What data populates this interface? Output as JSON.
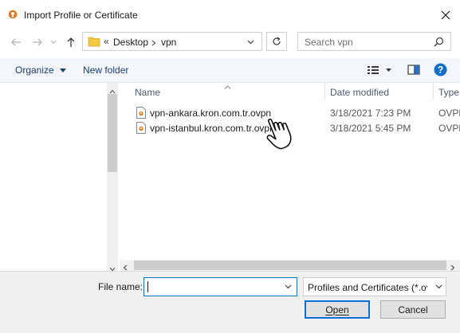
{
  "window": {
    "title": "Import Profile or Certificate"
  },
  "address": {
    "chevrons": "«",
    "crumbs": [
      "Desktop",
      "vpn"
    ]
  },
  "search": {
    "placeholder": "Search vpn"
  },
  "toolbar": {
    "organize": "Organize",
    "new_folder": "New folder"
  },
  "columns": {
    "name": "Name",
    "date": "Date modified",
    "type": "Type"
  },
  "files": [
    {
      "name": "vpn-ankara.kron.com.tr.ovpn",
      "date": "3/18/2021 7:23 PM",
      "type": "OVPN"
    },
    {
      "name": "vpn-istanbul.kron.com.tr.ovpn",
      "date": "3/18/2021 5:45 PM",
      "type": "OVPN"
    }
  ],
  "bottom": {
    "file_name_label": "File name:",
    "file_name_value": "",
    "filter": "Profiles and Certificates (*.ovpr",
    "open": "Open",
    "cancel": "Cancel"
  },
  "icons": {
    "app": "openvpn-icon",
    "close": "close-icon",
    "back": "back-arrow-icon",
    "forward": "forward-arrow-icon",
    "recent": "chevron-down-icon",
    "up": "up-arrow-icon",
    "folder": "folder-icon",
    "refresh": "refresh-icon",
    "search": "search-icon",
    "view": "view-options-icon",
    "pane": "preview-pane-icon",
    "help": "help-icon",
    "file": "ovpn-file-icon",
    "cursor": "hand-pointer-icon"
  },
  "colors": {
    "accent": "#0a6fd6",
    "toolbar_text": "#1a3e6e",
    "help_blue": "#1270c6",
    "app_orange": "#e07a1f"
  }
}
